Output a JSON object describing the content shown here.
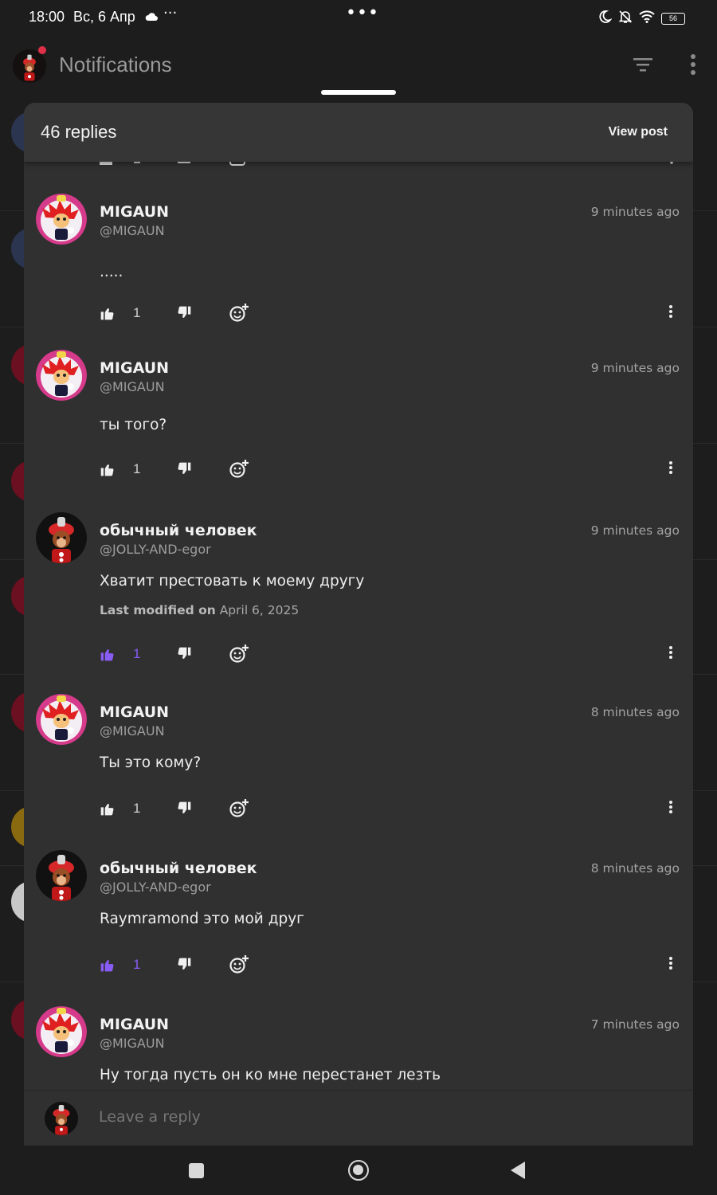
{
  "status_bar": {
    "time": "18:00",
    "date": "Вс, 6 Апр",
    "more": "···",
    "center": "•••",
    "battery": "56"
  },
  "app_bar": {
    "title": "Notifications"
  },
  "sheet": {
    "replies_count": "46 replies",
    "view_post": "View post"
  },
  "comments": [
    {
      "name": "MIGAUN",
      "handle": "@MIGAUN",
      "time": "9 minutes ago",
      "text": ".....",
      "likes": "1",
      "liked": false,
      "avatar": "migaun"
    },
    {
      "name": "MIGAUN",
      "handle": "@MIGAUN",
      "time": "9 minutes ago",
      "text": "ты того?",
      "likes": "1",
      "liked": false,
      "avatar": "migaun"
    },
    {
      "name": "обычный человек",
      "handle": "@JOLLY-AND-egor",
      "time": "9 minutes ago",
      "text": "Хватит престовать к моему другу",
      "modified_label": "Last modified on",
      "modified_date": "April 6, 2025",
      "likes": "1",
      "liked": true,
      "avatar": "jolly"
    },
    {
      "name": "MIGAUN",
      "handle": "@MIGAUN",
      "time": "8 minutes ago",
      "text": "Ты это кому?",
      "likes": "1",
      "liked": false,
      "avatar": "migaun"
    },
    {
      "name": "обычный человек",
      "handle": "@JOLLY-AND-egor",
      "time": "8 minutes ago",
      "text": "Raymramond это мой друг",
      "likes": "1",
      "liked": true,
      "avatar": "jolly"
    },
    {
      "name": "MIGAUN",
      "handle": "@MIGAUN",
      "time": "7 minutes ago",
      "text": "Ну тогда пусть он ко мне перестанет лезть",
      "avatar": "migaun"
    }
  ],
  "reply_bar": {
    "placeholder": "Leave a reply"
  },
  "colors": {
    "background": "#1d1d1d",
    "sheet": "#303030",
    "sheet_header": "#363636",
    "liked_accent": "#8a5cf6",
    "text_primary": "#f2f2f2",
    "text_secondary": "#9d9d9d"
  },
  "icons": [
    "cloud-icon",
    "moon-icon",
    "bell-off-icon",
    "wifi-icon",
    "battery-icon",
    "filter-icon",
    "vertical-dots-icon",
    "thumbs-up-icon",
    "thumbs-down-icon",
    "add-reaction-icon",
    "nav-recents-icon",
    "nav-home-icon",
    "nav-back-icon"
  ]
}
